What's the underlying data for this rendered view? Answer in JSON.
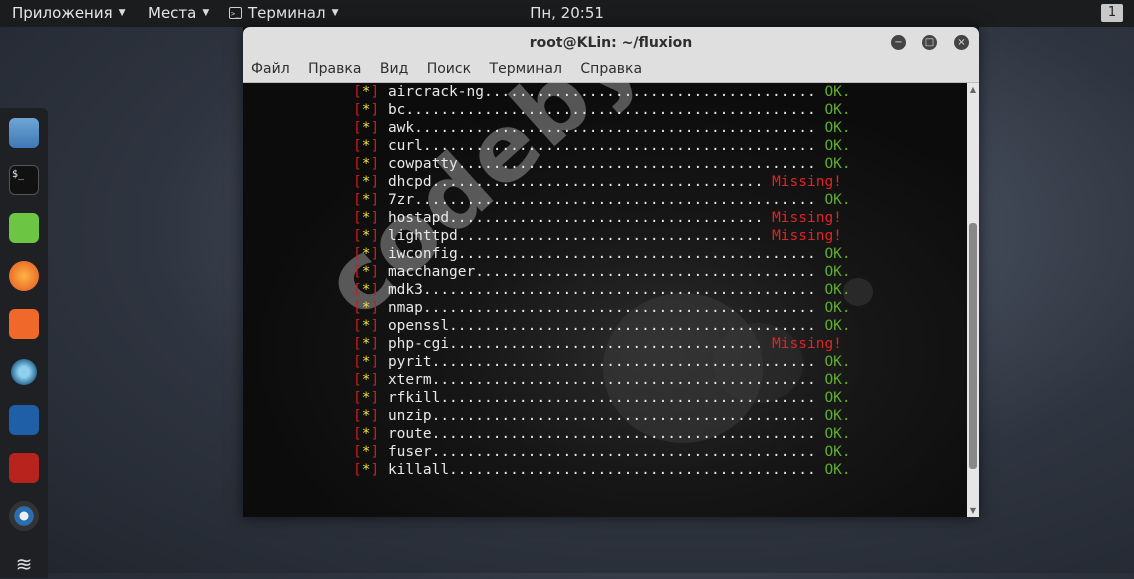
{
  "panel": {
    "apps_label": "Приложения",
    "places_label": "Места",
    "active_app_label": "Терминал",
    "clock": "Пн, 20:51",
    "workspace": "1"
  },
  "dock": {
    "items": [
      "files-icon",
      "terminal-app-icon",
      "notes-icon",
      "firefox-icon",
      "burpsuite-icon",
      "eye-icon",
      "metasploit-icon",
      "cherrytree-icon",
      "dots-app-icon",
      "wifi-icon"
    ]
  },
  "window": {
    "title": "root@KLin: ~/fluxion",
    "minimize": "−",
    "maximize": "□",
    "close": "×",
    "menu": [
      "Файл",
      "Правка",
      "Вид",
      "Поиск",
      "Терминал",
      "Справка"
    ]
  },
  "terminal": {
    "lines": [
      {
        "tool": "aircrack-ng",
        "dots": "......................................",
        "status": "OK."
      },
      {
        "tool": "bc",
        "dots": "...............................................",
        "status": "OK."
      },
      {
        "tool": "awk",
        "dots": "..............................................",
        "status": "OK."
      },
      {
        "tool": "curl",
        "dots": ".............................................",
        "status": "OK."
      },
      {
        "tool": "cowpatty",
        "dots": ".........................................",
        "status": "OK."
      },
      {
        "tool": "dhcpd",
        "dots": "......................................",
        "status": "Missing!"
      },
      {
        "tool": "7zr",
        "dots": "..............................................",
        "status": "OK."
      },
      {
        "tool": "hostapd",
        "dots": "....................................",
        "status": "Missing!"
      },
      {
        "tool": "lighttpd",
        "dots": "...................................",
        "status": "Missing!"
      },
      {
        "tool": "iwconfig",
        "dots": ".........................................",
        "status": "OK."
      },
      {
        "tool": "macchanger",
        "dots": ".......................................",
        "status": "OK."
      },
      {
        "tool": "mdk3",
        "dots": ".............................................",
        "status": "OK."
      },
      {
        "tool": "nmap",
        "dots": ".............................................",
        "status": "OK."
      },
      {
        "tool": "openssl",
        "dots": "..........................................",
        "status": "OK."
      },
      {
        "tool": "php-cgi",
        "dots": "....................................",
        "status": "Missing!"
      },
      {
        "tool": "pyrit",
        "dots": "............................................",
        "status": "OK."
      },
      {
        "tool": "xterm",
        "dots": "............................................",
        "status": "OK."
      },
      {
        "tool": "rfkill",
        "dots": "...........................................",
        "status": "OK."
      },
      {
        "tool": "unzip",
        "dots": "............................................",
        "status": "OK."
      },
      {
        "tool": "route",
        "dots": "............................................",
        "status": "OK."
      },
      {
        "tool": "fuser",
        "dots": "............................................",
        "status": "OK."
      },
      {
        "tool": "killall",
        "dots": "..........................................",
        "status": "OK."
      }
    ],
    "watermark": "codeby.net"
  },
  "colors": {
    "ok": "#5fae2c",
    "missing": "#e02424",
    "bracket": "#d01b1b",
    "star": "#f0e13a"
  }
}
